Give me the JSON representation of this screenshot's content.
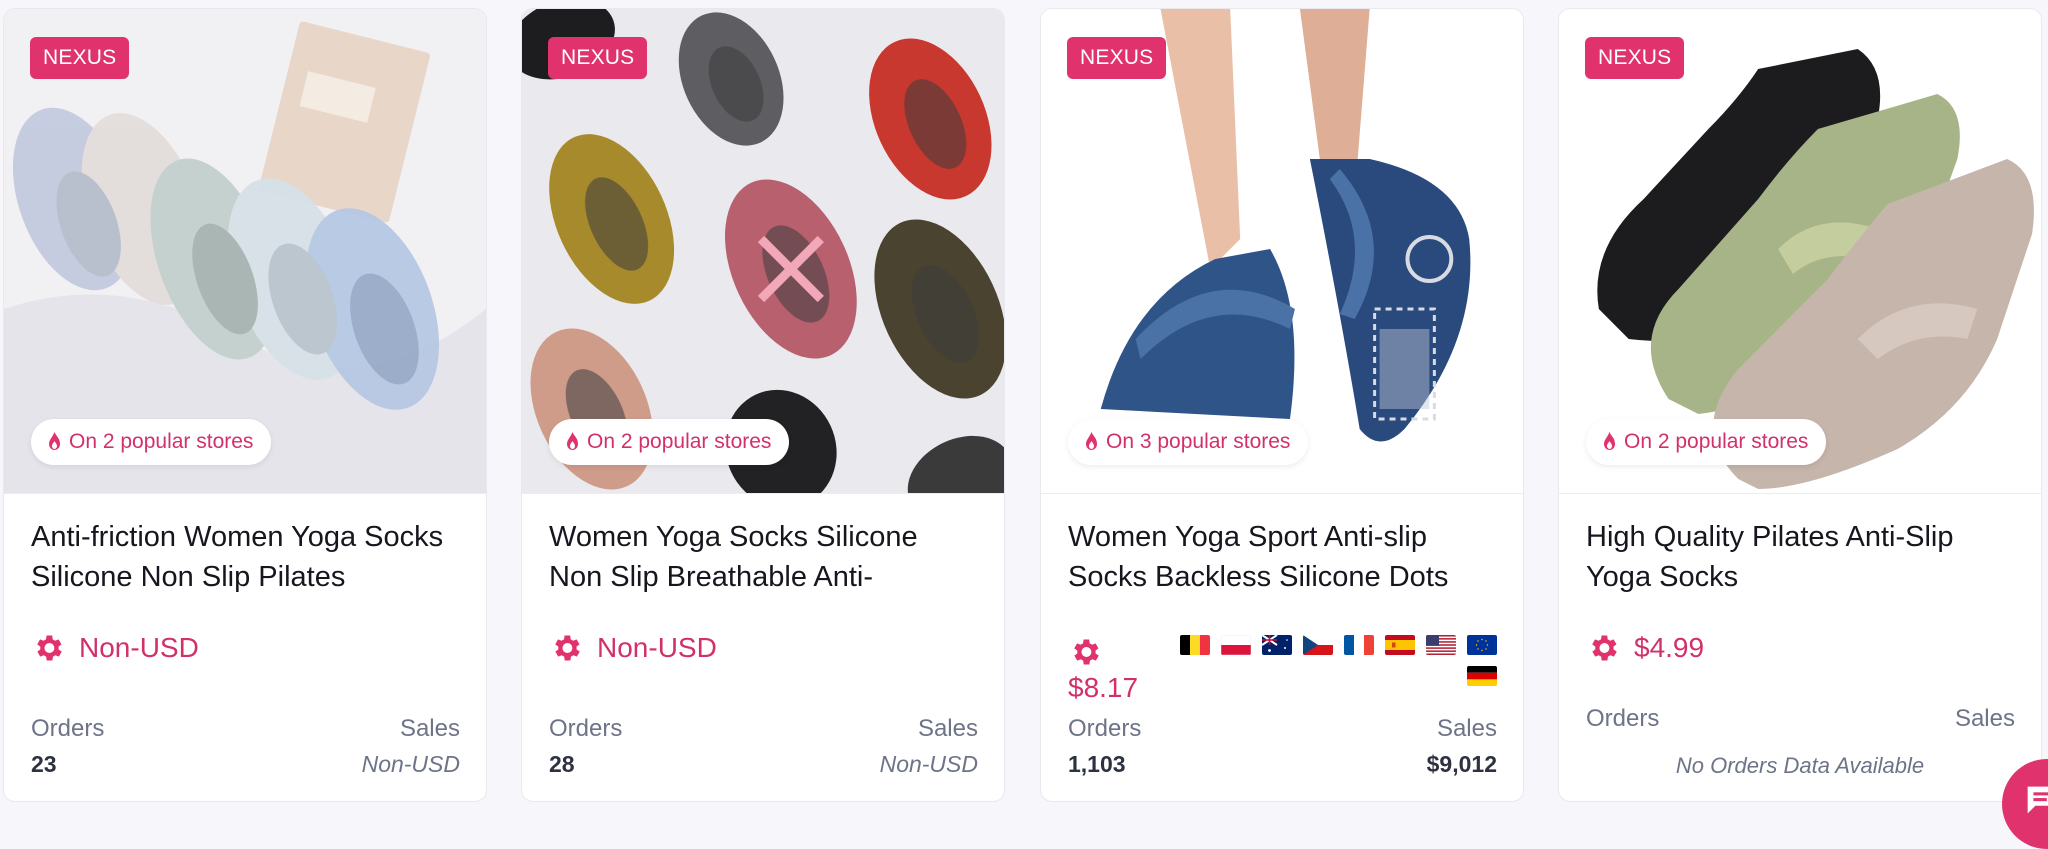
{
  "products": [
    {
      "badge": "NEXUS",
      "stores_text": "On 2 popular stores",
      "title": "Anti-friction Women Yoga Socks Silicone Non Slip Pilates",
      "price": "Non-USD",
      "orders_label": "Orders",
      "sales_label": "Sales",
      "orders": "23",
      "sales": "Non-USD",
      "image_icon": "yoga-socks-pastel-photo"
    },
    {
      "badge": "NEXUS",
      "stores_text": "On 2 popular stores",
      "title": "Women Yoga Socks Silicone Non Slip Breathable Anti-",
      "price": "Non-USD",
      "orders_label": "Orders",
      "sales_label": "Sales",
      "orders": "28",
      "sales": "Non-USD",
      "image_icon": "yoga-socks-colorful-photo"
    },
    {
      "badge": "NEXUS",
      "stores_text": "On 3 popular stores",
      "title": "Women Yoga Sport Anti-slip Socks Backless Silicone Dots",
      "price": "$8.17",
      "orders_label": "Orders",
      "sales_label": "Sales",
      "orders": "1,103",
      "sales": "$9,012",
      "flags": [
        "belgium",
        "poland",
        "australia",
        "czech-republic",
        "france",
        "spain",
        "united-states",
        "european-union",
        "germany"
      ],
      "image_icon": "yoga-sock-blue-feet-photo"
    },
    {
      "badge": "NEXUS",
      "stores_text": "On 2 popular stores",
      "title": "High Quality Pilates Anti-Slip Yoga Socks",
      "price": "$4.99",
      "orders_label": "Orders",
      "sales_label": "Sales",
      "no_data_text": "No Orders Data Available",
      "image_icon": "pilates-socks-three-photo"
    }
  ],
  "colors": {
    "accent": "#e0336e",
    "price": "#d2306b",
    "muted": "#6e7488"
  },
  "chat_button_icon": "chat-icon"
}
